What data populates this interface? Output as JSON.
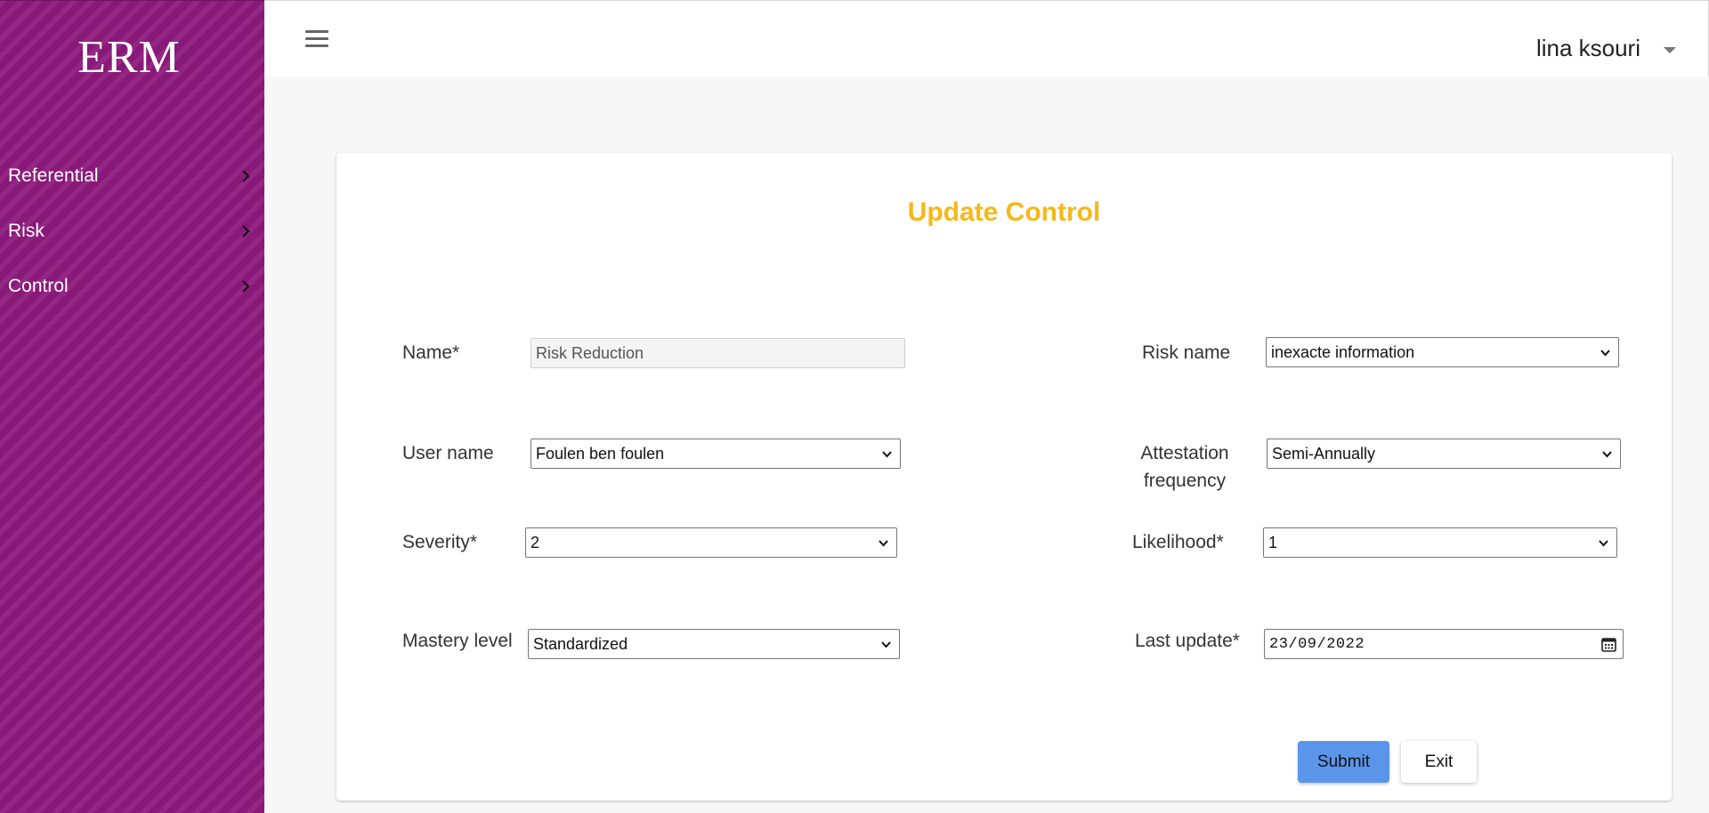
{
  "sidebar": {
    "logo": "ERM",
    "items": [
      {
        "label": "Referential"
      },
      {
        "label": "Risk"
      },
      {
        "label": "Control"
      }
    ]
  },
  "header": {
    "user_name": "lina ksouri",
    "menu_icon": "hamburger-menu-icon",
    "user_menu_icon": "caret-down-icon"
  },
  "form": {
    "title": "Update Control",
    "name": {
      "label": "Name*",
      "value": "Risk Reduction"
    },
    "risk_name": {
      "label": "Risk name",
      "value": "inexacte information"
    },
    "user_name": {
      "label": "User name",
      "value": "Foulen ben foulen"
    },
    "attestation_frequency": {
      "label_line1": "Attestation",
      "label_line2": "frequency",
      "value": "Semi-Annually"
    },
    "severity": {
      "label": "Severity*",
      "value": "2"
    },
    "likelihood": {
      "label": "Likelihood*",
      "value": "1"
    },
    "mastery_level": {
      "label": "Mastery level",
      "value": "Standardized"
    },
    "last_update": {
      "label": "Last update*",
      "value": "23/09/2022"
    },
    "submit_label": "Submit",
    "exit_label": "Exit"
  },
  "colors": {
    "sidebar_bg": "#8e1a7d",
    "title": "#f6b81a",
    "submit_bg": "#5b95ea"
  }
}
